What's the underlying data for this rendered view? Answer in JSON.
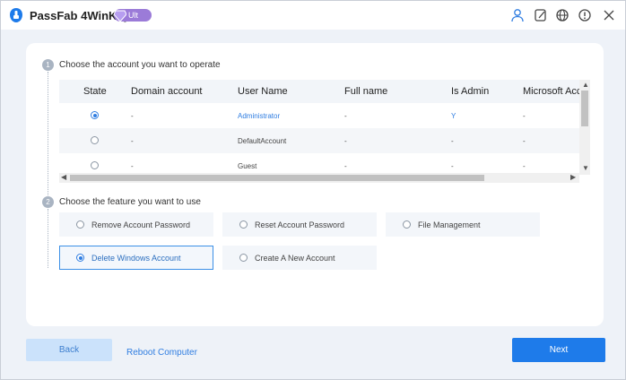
{
  "app": {
    "name": "PassFab 4WinKey",
    "edition": "Ult"
  },
  "toolbar_icons": [
    "user-icon",
    "note-icon",
    "globe-icon",
    "info-icon",
    "close-icon"
  ],
  "step1": {
    "num": "1",
    "label": "Choose the account you want to operate"
  },
  "table": {
    "columns": [
      "State",
      "Domain account",
      "User Name",
      "Full name",
      "Is Admin",
      "Microsoft Acc"
    ],
    "rows": [
      {
        "selected": true,
        "domain": "-",
        "user": "Administrator",
        "full": "-",
        "admin": "Y",
        "ms": "-"
      },
      {
        "selected": false,
        "domain": "-",
        "user": "DefaultAccount",
        "full": "-",
        "admin": "-",
        "ms": "-"
      },
      {
        "selected": false,
        "domain": "-",
        "user": "Guest",
        "full": "-",
        "admin": "-",
        "ms": "-"
      }
    ]
  },
  "step2": {
    "num": "2",
    "label": "Choose the feature you want to use"
  },
  "features": [
    {
      "label": "Remove Account Password",
      "selected": false
    },
    {
      "label": "Reset Account Password",
      "selected": false
    },
    {
      "label": "File Management",
      "selected": false
    },
    {
      "label": "Delete Windows Account",
      "selected": true
    },
    {
      "label": "Create A New Account",
      "selected": false
    }
  ],
  "footer": {
    "back": "Back",
    "reboot": "Reboot Computer",
    "next": "Next"
  },
  "colors": {
    "accent": "#1e7bea",
    "badge": "#9b7bd8",
    "back_bg": "#cbe2fb"
  }
}
